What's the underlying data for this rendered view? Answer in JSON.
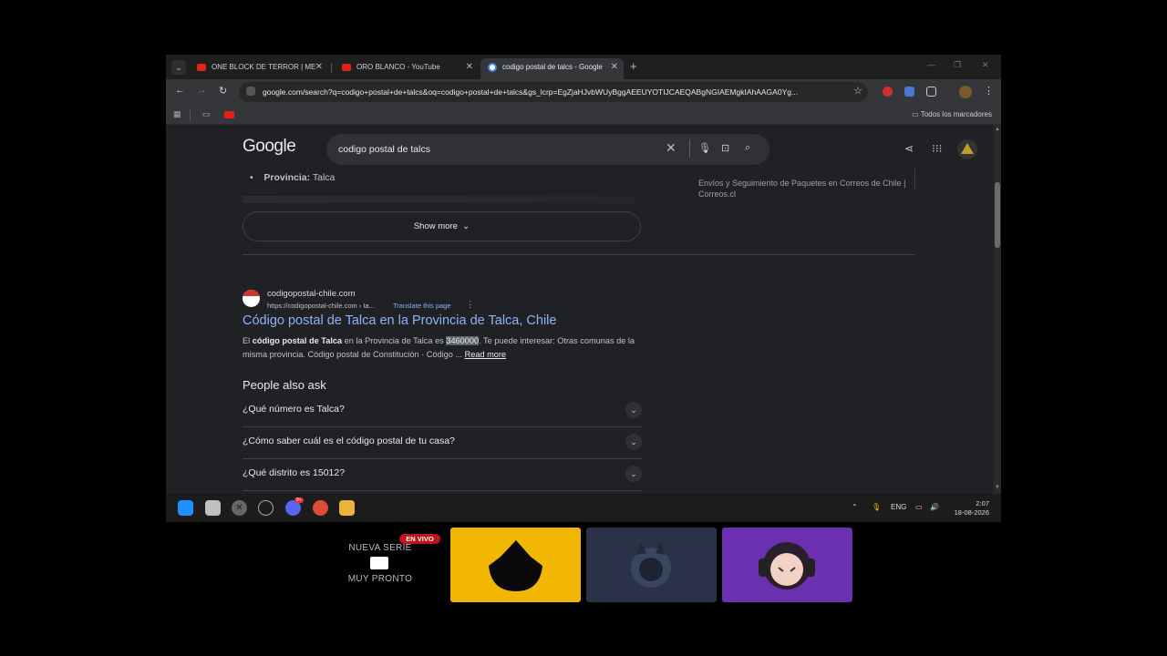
{
  "tabs": [
    {
      "title": "ONE BLOCK DE TERROR | MEJOR"
    },
    {
      "title": "ORO BLANCO - YouTube"
    },
    {
      "title": "codigo postal de talcs - Google"
    }
  ],
  "toolbar": {
    "url": "google.com/search?q=codigo+postal+de+talcs&oq=codigo+postal+de+talcs&gs_lcrp=EgZjaHJvbWUyBggAEEUYOTIJCAEQABgNGIAEMgkIAhAAGA0Yg..."
  },
  "bookmarks": {
    "all_label": "Todos los marcadores"
  },
  "google": {
    "logo": "Google",
    "query": "codigo postal de talcs",
    "province_label": "Provincia:",
    "province_value": "Talca",
    "side_text": "Envíos y Seguimiento de Paquetes en Correos de Chile | Correos.cl",
    "show_more": "Show more",
    "result": {
      "site": "codigopostal-chile.com",
      "url": "https://codigopostal-chile.com › ta...",
      "translate": "Translate this page",
      "title": "Código postal de Talca en la Provincia de Talca, Chile",
      "snip_1": "El ",
      "snip_bold": "código postal de Talca",
      "snip_2": " en la Provincia de Talca es ",
      "snip_hl": "3460000",
      "snip_3": ". Te puede interesar: Otras comunas de la misma provincia. Código postal de Constitución · Código ... ",
      "read_more": "Read more"
    },
    "paa_title": "People also ask",
    "paa": [
      {
        "q": "¿Qué número es Talca?"
      },
      {
        "q": "¿Cómo saber cuál es el código postal de tu casa?"
      },
      {
        "q": "¿Qué distrito es 15012?"
      }
    ]
  },
  "taskbar": {
    "lang": "ENG",
    "time": "2:07",
    "date": "18-08-2026",
    "discord_badge": "9+"
  },
  "overlay": {
    "line1": "NUEVA SERIE",
    "line2": "MUY PRONTO",
    "live": "EN VIVO"
  },
  "colors": {
    "link": "#8ab4f8",
    "page_bg": "#202124",
    "live": "#c1121f",
    "card_yellow": "#f2b705",
    "card_purple": "#6a30b0"
  }
}
